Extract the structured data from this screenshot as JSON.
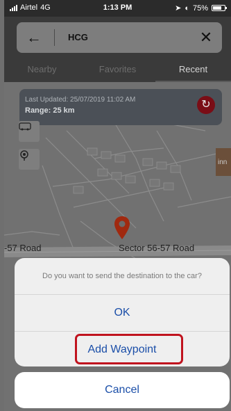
{
  "status_bar": {
    "carrier": "Airtel",
    "network": "4G",
    "time": "1:13 PM",
    "battery": "75%",
    "battery_level": 0.75
  },
  "search": {
    "query": "HCG",
    "back_icon": "arrow-left-icon",
    "clear_icon": "close-icon"
  },
  "tabs": [
    {
      "label": "Nearby",
      "active": false
    },
    {
      "label": "Favorites",
      "active": false
    },
    {
      "label": "Recent",
      "active": true
    }
  ],
  "info_card": {
    "last_updated": "Last Updated: 25/07/2019 11:02 AM",
    "range": "Range: 25 km"
  },
  "map": {
    "road_label_left": "-57 Road",
    "road_label_right": "Sector 56-57  Road",
    "side_label": "inn"
  },
  "action_sheet": {
    "message": "Do you want to send the destination to the car?",
    "ok_label": "OK",
    "add_waypoint_label": "Add Waypoint",
    "cancel_label": "Cancel"
  },
  "colors": {
    "action_blue": "#1a4ea8",
    "highlight_red": "#c0131e",
    "refresh_red": "#7a0d16"
  }
}
